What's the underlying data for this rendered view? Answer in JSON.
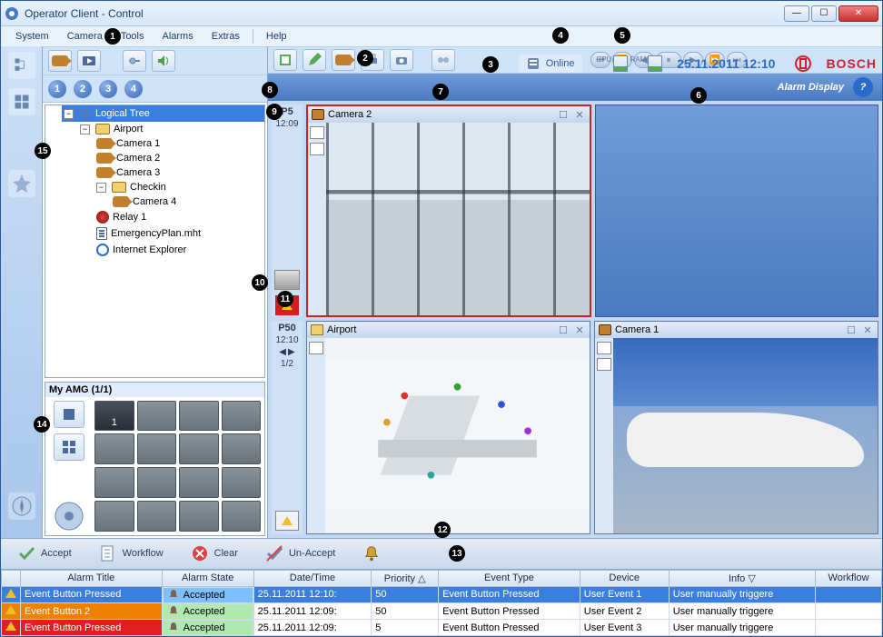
{
  "window": {
    "title": "Operator Client - Control"
  },
  "menu": {
    "system": "System",
    "camera": "Camera",
    "tools": "Tools",
    "alarms": "Alarms",
    "extras": "Extras",
    "help": "Help"
  },
  "status": {
    "online": "Online",
    "cpu": "CPU",
    "ram": "RAM",
    "datetime": "25.11.2011 12:10",
    "brand": "BOSCH"
  },
  "alarm_display": "Alarm Display",
  "layout": {
    "n1": "1",
    "n2": "2",
    "n3": "3",
    "n4": "4"
  },
  "tree": {
    "root": "Logical Tree",
    "airport": "Airport",
    "cam1": "Camera 1",
    "cam2": "Camera 2",
    "cam3": "Camera 3",
    "checkin": "Checkin",
    "cam4": "Camera 4",
    "relay": "Relay 1",
    "eplan": "EmergencyPlan.mht",
    "ie": "Internet Explorer"
  },
  "amg": {
    "title": "My AMG (1/1)",
    "active": "1"
  },
  "pcols": {
    "p1": {
      "title": "P5",
      "time": "12:09"
    },
    "p2": {
      "title": "P50",
      "time": "12:10",
      "page": "1/2"
    }
  },
  "panes": {
    "a": {
      "title": "Camera 2"
    },
    "b": {
      "title": "Airport"
    },
    "c": {
      "title": "Camera 1"
    }
  },
  "alarmbar": {
    "accept": "Accept",
    "workflow": "Workflow",
    "clear": "Clear",
    "unaccept": "Un-Accept"
  },
  "table": {
    "headers": {
      "title": "Alarm Title",
      "state": "Alarm State",
      "dt": "Date/Time",
      "prio": "Priority",
      "type": "Event Type",
      "device": "Device",
      "info": "Info",
      "wf": "Workflow"
    },
    "rows": [
      {
        "title": "Event Button Pressed",
        "state": "Accepted",
        "dt": "25.11.2011 12:10:",
        "prio": "50",
        "type": "Event Button Pressed",
        "device": "User Event 1",
        "info": "User manually triggere"
      },
      {
        "title": "Event Button 2",
        "state": "Accepted",
        "dt": "25.11.2011 12:09:",
        "prio": "50",
        "type": "Event Button Pressed",
        "device": "User Event 2",
        "info": "User manually triggere"
      },
      {
        "title": "Event Button Pressed",
        "state": "Accepted",
        "dt": "25.11.2011 12:09:",
        "prio": "5",
        "type": "Event Button Pressed",
        "device": "User Event 3",
        "info": "User manually triggere"
      }
    ]
  },
  "markers": [
    "1",
    "2",
    "3",
    "4",
    "5",
    "6",
    "7",
    "8",
    "9",
    "10",
    "11",
    "12",
    "13",
    "14",
    "15"
  ]
}
